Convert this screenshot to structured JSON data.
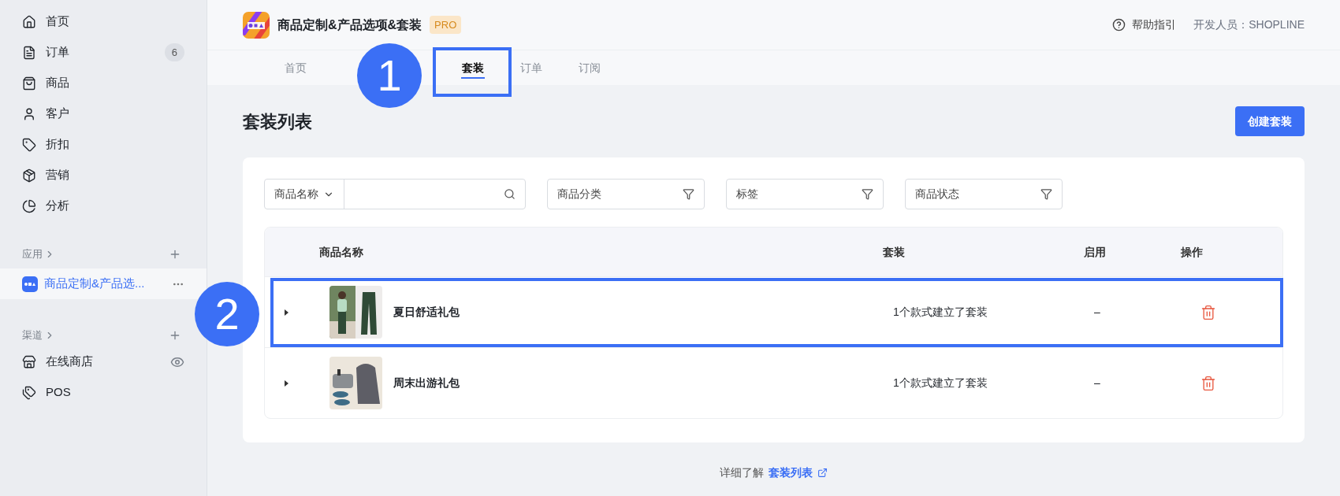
{
  "sidebar": {
    "items": [
      {
        "kind": "home",
        "label": "首页",
        "selected": false
      },
      {
        "kind": "orders",
        "label": "订单",
        "badge": "6",
        "selected": false
      },
      {
        "kind": "products",
        "label": "商品",
        "selected": false
      },
      {
        "kind": "customers",
        "label": "客户",
        "selected": false
      },
      {
        "kind": "discounts",
        "label": "折扣",
        "selected": false
      },
      {
        "kind": "marketing",
        "label": "营销",
        "selected": false
      },
      {
        "kind": "analytics",
        "label": "分析",
        "selected": false
      }
    ],
    "apps": {
      "heading": "应用",
      "items": [
        {
          "label": "商品定制&产品选...",
          "selected": true
        }
      ]
    },
    "channels": {
      "heading": "渠道",
      "items": [
        {
          "kind": "store",
          "label": "在线商店"
        },
        {
          "kind": "pos",
          "label": "POS"
        }
      ]
    }
  },
  "header": {
    "app_name": "商品定制&产品选项&套装",
    "badge": "PRO",
    "help": "帮助指引",
    "developer": "开发人员：SHOPLINE"
  },
  "tabs": [
    {
      "label": "首页",
      "selected": false
    },
    {
      "label": "套装",
      "selected": true
    },
    {
      "label": "订单",
      "selected": false
    },
    {
      "label": "订阅",
      "selected": false
    }
  ],
  "page": {
    "title": "套装列表",
    "create_button": "创建套装"
  },
  "filters": {
    "search_select": "商品名称",
    "dropdowns": [
      "商品分类",
      "标签",
      "商品状态"
    ]
  },
  "table": {
    "columns": [
      "商品名称",
      "套装",
      "启用",
      "操作"
    ],
    "rows": [
      {
        "name": "夏日舒适礼包",
        "bundle": "1个款式建立了套装",
        "enabled": "–",
        "expanded": false
      },
      {
        "name": "周末出游礼包",
        "bundle": "1个款式建立了套装",
        "enabled": "–",
        "expanded": false
      }
    ]
  },
  "footer": {
    "text": "详细了解",
    "link": "套装列表"
  },
  "callouts": [
    {
      "number": "1"
    },
    {
      "number": "2"
    }
  ]
}
